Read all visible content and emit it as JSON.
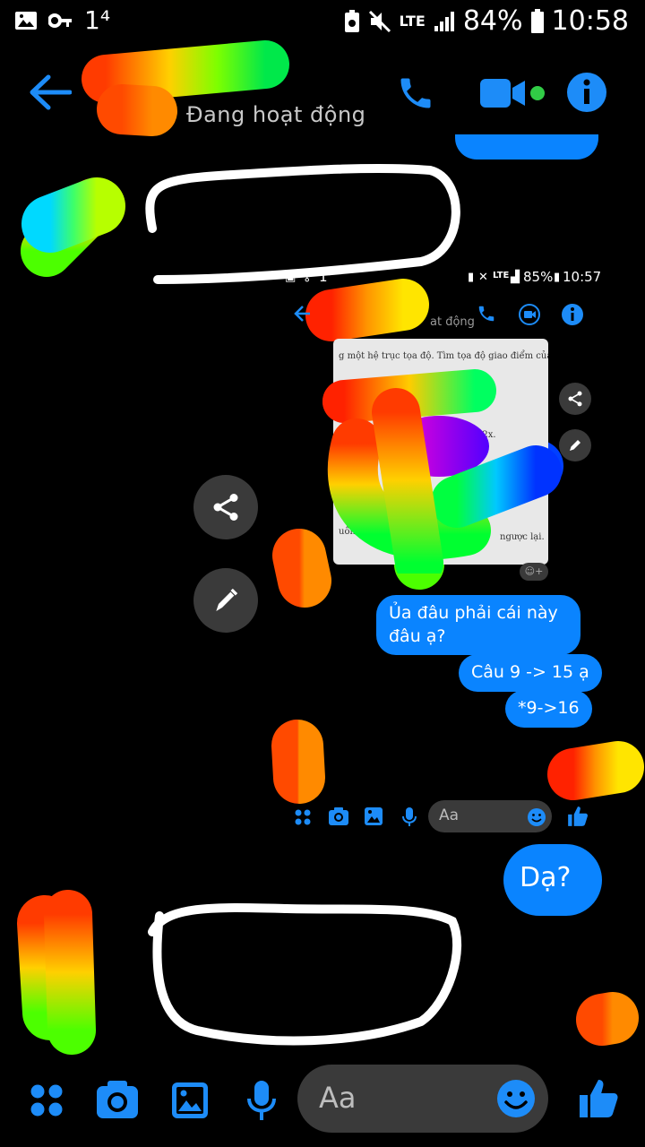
{
  "status_bar": {
    "notification_count": "1⁴",
    "network": "LTE",
    "battery": "84%",
    "time": "10:58"
  },
  "header": {
    "status": "Đang hoạt động"
  },
  "screenshot_preview": {
    "status_bar": {
      "count": "1'",
      "network": "LTE",
      "battery": "85%",
      "time": "10:57"
    },
    "header_status": "at động",
    "doc_lines": [
      "g một hệ trục tọa độ. Tìm tọa độ giao điểm của (P) và",
      "−2x.",
      "uôn khô",
      "ngược lại."
    ],
    "composer_placeholder": "Aa",
    "reaction_add": "☺+"
  },
  "messages": [
    {
      "text": "Ủa đâu phải cái này đâu ạ?"
    },
    {
      "text": "Câu 9 -> 15 ạ"
    },
    {
      "text": "*9->16"
    },
    {
      "text": "Dạ?"
    }
  ],
  "composer": {
    "placeholder": "Aa"
  },
  "colors": {
    "accent": "#0a84ff",
    "icon_blue": "#1d8cf8",
    "background": "#000000",
    "surface": "#3a3a3a"
  }
}
